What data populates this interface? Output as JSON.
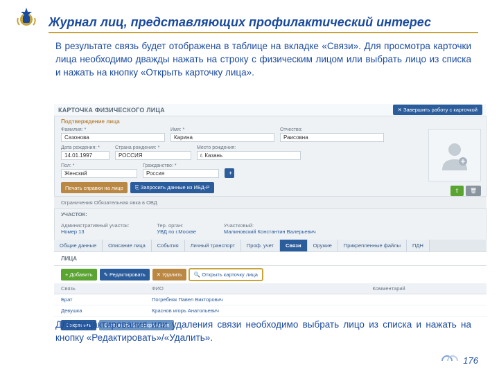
{
  "headline": "Журнал лиц, представляющих профилактический интерес",
  "intro": "В результате связь будет отображена в таблице на вкладке «Связи». Для просмотра карточки лица необходимо дважды нажать на строку с физическим лицом или выбрать лицо из списка и нажать на кнопку «Открыть карточку лица».",
  "card": {
    "title": "КАРТОЧКА ФИЗИЧЕСКОГО ЛИЦА",
    "close_btn": "✕  Завершить работу с карточкой",
    "subhead": "Подтверждение лица",
    "labels": {
      "fam": "Фамилия: *",
      "name": "Имя: *",
      "patr": "Отчество:",
      "dob": "Дата рождения: *",
      "country": "Страна рождения: *",
      "place": "Место рождения:",
      "sex": "Пол: *",
      "citizen": "Гражданство: *"
    },
    "values": {
      "fam": "Сазонова",
      "name": "Карина",
      "patr": "Раисовна",
      "dob": "14.01.1997",
      "country": "РОССИЯ",
      "place": "г. Казань",
      "sex": "Женский",
      "citizen": "Россия"
    },
    "print_btn": "Печать справки на лицо",
    "ibd_btn": "⎘ Запросить данные из ИБД-Р",
    "restrict_bar": "Ограничения Обязательная явка в ОВД",
    "participok_title": "УЧАСТОК:",
    "participok_row": {
      "c1l": "Административный участок:",
      "c1v": "Номер 13",
      "c2l": "Тер. орган:",
      "c2v": "УВД по г.Москве",
      "c3l": "Участковый:",
      "c3v": "Малиновский Константин Валерьевич"
    },
    "tabs": [
      "Общие данные",
      "Описание лица",
      "События",
      "Личный транспорт",
      "Проф. учет",
      "Связи",
      "Оружие",
      "Прикрепленные файлы",
      "ПДН"
    ],
    "active_tab": 5,
    "table_title": "ЛИЦА",
    "tb_btns": {
      "add": "+ Добавить",
      "edit": "✎ Редактировать",
      "del": "✕ Удалить",
      "open": "🔍 Открыть карточку лица"
    },
    "table": {
      "head": [
        "Связь",
        "ФИО",
        "Комментарий"
      ],
      "rows": [
        [
          "Брат",
          "Погребняк Павел Викторович",
          ""
        ],
        [
          "Девушка",
          "Краснов игорь Анатольевич",
          ""
        ]
      ]
    },
    "save": "Сохранить",
    "save_noclose": "Сохранить без сохранения"
  },
  "outro": "Для редактирования или удаления  связи необходимо выбрать лицо из списка и нажать на кнопку «Редактировать»/«Удалить».",
  "page": "176"
}
